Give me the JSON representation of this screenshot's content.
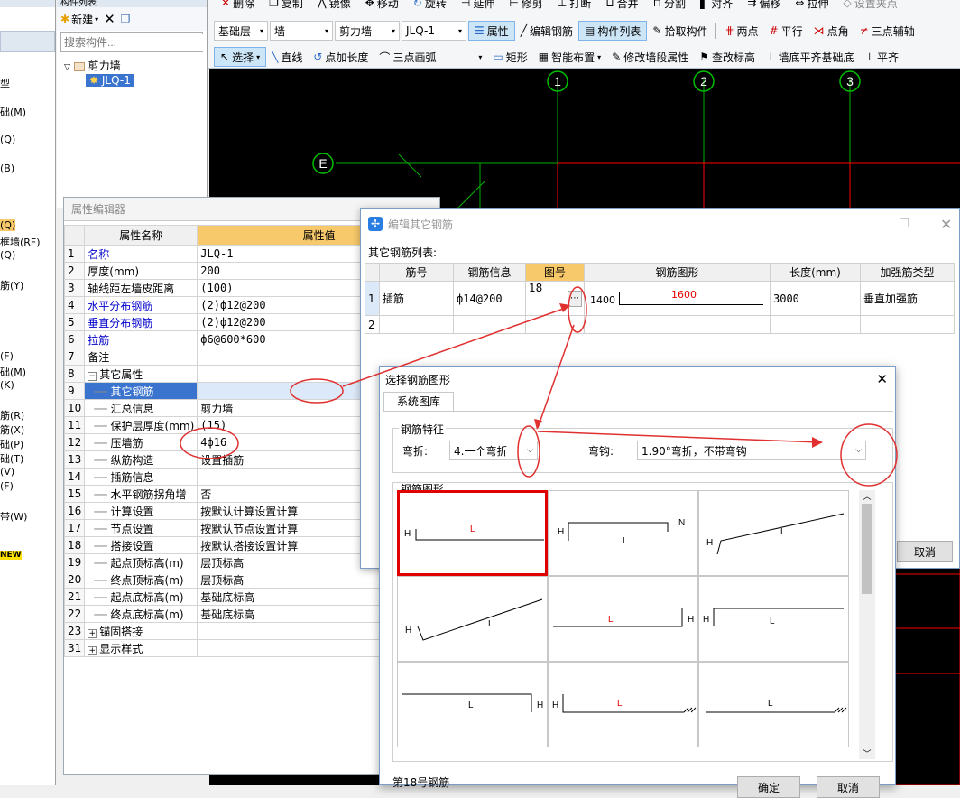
{
  "left_panel": {
    "items": [
      "型",
      "础(M)",
      "(Q)",
      "(B)",
      "(Q)",
      "框墙(RF)",
      "(Q)",
      "筋(Y)",
      "(F)",
      "础(M)",
      "(K)",
      "筋(R)",
      "筋(X)",
      "础(P)",
      "础(T)",
      "(V)",
      "(F)",
      "带(W)",
      "NEW"
    ]
  },
  "component_list": {
    "title": "构件列表",
    "new_label": "新建",
    "search_placeholder": "搜索构件...",
    "tree_parent": "剪力墙",
    "tree_child": "JLQ-1"
  },
  "toolbar": {
    "row1": [
      "删除",
      "复制",
      "镜像",
      "移动",
      "旋转",
      "延伸",
      "修剪",
      "打断",
      "合并",
      "分割",
      "对齐",
      "偏移",
      "拉伸",
      "设置夹点"
    ],
    "row2": {
      "floor": "基础层",
      "type": "墙",
      "subtype": "剪力墙",
      "component": "JLQ-1",
      "buttons": [
        "属性",
        "编辑钢筋",
        "构件列表",
        "拾取构件",
        "两点",
        "平行",
        "点角",
        "三点辅轴"
      ]
    },
    "row3": [
      "选择",
      "直线",
      "点加长度",
      "三点画弧",
      "矩形",
      "智能布置",
      "修改墙段属性",
      "查改标高",
      "墙底平齐基础底",
      "平齐"
    ]
  },
  "cad": {
    "axis_labels": [
      "1",
      "2",
      "3",
      "E"
    ]
  },
  "property_editor": {
    "title": "属性编辑器",
    "col_name": "属性名称",
    "col_value": "属性值",
    "rows": [
      {
        "n": "1",
        "name": "名称",
        "value": "JLQ-1",
        "blue": true
      },
      {
        "n": "2",
        "name": "厚度(mm)",
        "value": "200"
      },
      {
        "n": "3",
        "name": "轴线距左墙皮距离",
        "value": "(100)"
      },
      {
        "n": "4",
        "name": "水平分布钢筋",
        "value": "(2)ф12@200",
        "blue": true
      },
      {
        "n": "5",
        "name": "垂直分布钢筋",
        "value": "(2)ф12@200",
        "blue": true
      },
      {
        "n": "6",
        "name": "拉筋",
        "value": "ф6@600*600",
        "blue": true
      },
      {
        "n": "7",
        "name": "备注",
        "value": ""
      },
      {
        "n": "8",
        "name": "其它属性",
        "value": "",
        "group": true
      },
      {
        "n": "9",
        "name": "其它钢筋",
        "value": "",
        "selected": true
      },
      {
        "n": "10",
        "name": "汇总信息",
        "value": "剪力墙"
      },
      {
        "n": "11",
        "name": "保护层厚度(mm)",
        "value": "(15)"
      },
      {
        "n": "12",
        "name": "压墙筋",
        "value": "4ф16"
      },
      {
        "n": "13",
        "name": "纵筋构造",
        "value": "设置插筋"
      },
      {
        "n": "14",
        "name": "插筋信息",
        "value": ""
      },
      {
        "n": "15",
        "name": "水平钢筋拐角增",
        "value": "否"
      },
      {
        "n": "16",
        "name": "计算设置",
        "value": "按默认计算设置计算"
      },
      {
        "n": "17",
        "name": "节点设置",
        "value": "按默认节点设置计算"
      },
      {
        "n": "18",
        "name": "搭接设置",
        "value": "按默认搭接设置计算"
      },
      {
        "n": "19",
        "name": "起点顶标高(m)",
        "value": "层顶标高"
      },
      {
        "n": "20",
        "name": "终点顶标高(m)",
        "value": "层顶标高"
      },
      {
        "n": "21",
        "name": "起点底标高(m)",
        "value": "基础底标高"
      },
      {
        "n": "22",
        "name": "终点底标高(m)",
        "value": "基础底标高"
      },
      {
        "n": "23",
        "name": "锚固搭接",
        "value": "",
        "group": true
      },
      {
        "n": "31",
        "name": "显示样式",
        "value": "",
        "group": true
      }
    ]
  },
  "edit_rebar_dialog": {
    "title": "编辑其它钢筋",
    "list_label": "其它钢筋列表:",
    "headers": [
      "筋号",
      "钢筋信息",
      "图号",
      "钢筋图形",
      "长度(mm)",
      "加强筋类型"
    ],
    "rows": [
      {
        "n": "1",
        "name": "插筋",
        "info": "ф14@200",
        "fig": "18",
        "shape_left": "1400",
        "shape_mid": "1600",
        "length": "3000",
        "type": "垂直加强筋"
      },
      {
        "n": "2",
        "name": "",
        "info": "",
        "fig": "",
        "shape_left": "",
        "shape_mid": "",
        "length": "",
        "type": ""
      }
    ],
    "cancel": "取消"
  },
  "shape_dialog": {
    "title": "选择钢筋图形",
    "tab": "系统图库",
    "feature_group": "钢筋特征",
    "bend_label": "弯折:",
    "bend_value": "4.一个弯折",
    "hook_label": "弯钩:",
    "hook_value": "1.90°弯折，不带弯钩",
    "shapes_group": "钢筋图形",
    "status": "第18号钢筋",
    "ok": "确定",
    "cancel": "取消",
    "shape_labels": {
      "H": "H",
      "L": "L",
      "N": "N"
    }
  },
  "colors": {
    "selection": "#3b74cf",
    "header_accent": "#f7c96a",
    "annotation": "#e03030",
    "grid_green": "#00b000",
    "grid_red": "#ff0000"
  }
}
